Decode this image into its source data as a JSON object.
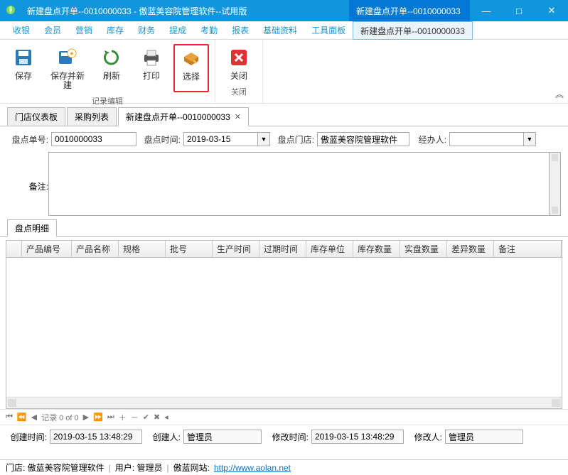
{
  "title": "新建盘点开单--0010000033 - 傲蓝美容院管理软件--试用版",
  "activeDocTab": "新建盘点开单--0010000033",
  "winbtns": {
    "min": "—",
    "max": "□",
    "close": "✕"
  },
  "menu": [
    "收银",
    "会员",
    "营销",
    "库存",
    "财务",
    "提成",
    "考勤",
    "报表",
    "基础资料",
    "工具面板",
    "新建盘点开单--0010000033"
  ],
  "ribbon": {
    "groups": [
      {
        "label": "记录编辑",
        "items": [
          {
            "name": "save",
            "label": "保存"
          },
          {
            "name": "save-new",
            "label": "保存并新建"
          },
          {
            "name": "refresh",
            "label": "刷新"
          },
          {
            "name": "print",
            "label": "打印"
          },
          {
            "name": "select",
            "label": "选择",
            "highlight": true
          }
        ]
      },
      {
        "label": "关闭",
        "items": [
          {
            "name": "close",
            "label": "关闭"
          }
        ]
      }
    ]
  },
  "docTabs": [
    "门店仪表板",
    "采购列表",
    "新建盘点开单--0010000033"
  ],
  "form": {
    "labels": {
      "no": "盘点单号:",
      "time": "盘点时间:",
      "store": "盘点门店:",
      "clerk": "经办人:",
      "remark": "备注:"
    },
    "no": "0010000033",
    "time": "2019-03-15",
    "store": "傲蓝美容院管理软件",
    "clerk": "",
    "remark": ""
  },
  "detailTab": "盘点明细",
  "gridCols": [
    "",
    "产品编号",
    "产品名称",
    "规格",
    "批号",
    "生产时间",
    "过期时间",
    "库存单位",
    "库存数量",
    "实盘数量",
    "差异数量",
    "备注"
  ],
  "nav": "记录 0 of 0",
  "bottom": {
    "labels": {
      "ct": "创建时间:",
      "cu": "创建人:",
      "mt": "修改时间:",
      "mu": "修改人:"
    },
    "ct": "2019-03-15 13:48:29",
    "cu": "管理员",
    "mt": "2019-03-15 13:48:29",
    "mu": "管理员"
  },
  "status": {
    "store": "门店:  傲蓝美容院管理软件",
    "user": "用户:  管理员",
    "siteLabel": "傲蓝网站:",
    "siteUrl": "http://www.aolan.net"
  }
}
